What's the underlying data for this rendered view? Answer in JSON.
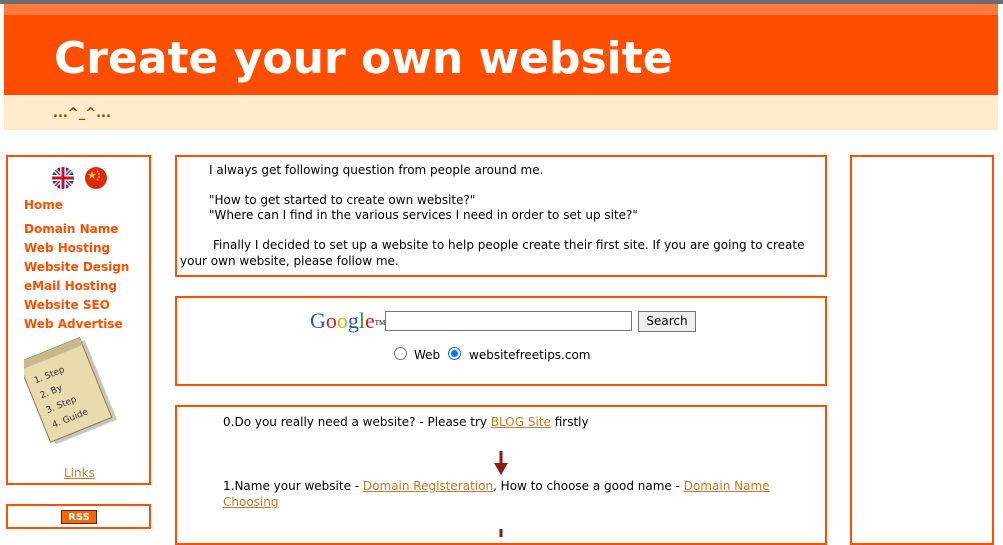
{
  "header": {
    "title": "Create your own website",
    "subtitle": "...^_^..."
  },
  "sidebar": {
    "flags": [
      "uk-flag-icon",
      "china-flag-icon"
    ],
    "home": "Home",
    "items": [
      {
        "label": "Domain Name"
      },
      {
        "label": "Web Hosting"
      },
      {
        "label": "Website Design"
      },
      {
        "label": "eMail Hosting"
      },
      {
        "label": "Website SEO"
      },
      {
        "label": "Web Advertise"
      }
    ],
    "note_lines": [
      "1. Step",
      "2. By",
      "3. Step",
      "4. Guide"
    ],
    "links_label": "Links",
    "rss_label": "RSS"
  },
  "intro": {
    "line1": "I always get following question from people around me.",
    "quote1": "\"How to get started to create own website?\"",
    "quote2": "\"Where can I find  in the various services I need in order to set up  site?\"",
    "para_line1": "Finally I decided to set up a website to help people create their first site. If you are going to create",
    "para_line2": "your own website, please follow me."
  },
  "search": {
    "logo": "Google",
    "tm": "TM",
    "query_value": "",
    "button_label": "Search",
    "radio_web": "Web",
    "radio_site": "websitefreetips.com",
    "selected": "websitefreetips.com"
  },
  "steps": {
    "step0_text": "0.Do you really need a website? - Please try ",
    "step0_link": "BLOG Site",
    "step0_tail": " firstly",
    "step1_text": "1.Name your website - ",
    "step1_link1": "Domain Registeration",
    "step1_mid": ", How to choose a good name - ",
    "step1_link2a": "Domain Name",
    "step1_link2b": "Choosing"
  },
  "colors": {
    "accent": "#ff4e00",
    "link": "#c47a2a",
    "subtitle_bg": "#ffeccc",
    "arrow": "#8b1a1a"
  }
}
